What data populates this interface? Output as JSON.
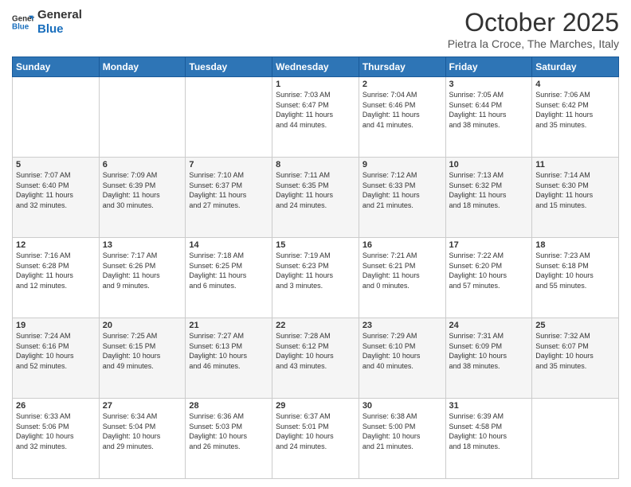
{
  "header": {
    "logo_line1": "General",
    "logo_line2": "Blue",
    "month_title": "October 2025",
    "location": "Pietra la Croce, The Marches, Italy"
  },
  "days_of_week": [
    "Sunday",
    "Monday",
    "Tuesday",
    "Wednesday",
    "Thursday",
    "Friday",
    "Saturday"
  ],
  "weeks": [
    [
      {
        "day": "",
        "info": ""
      },
      {
        "day": "",
        "info": ""
      },
      {
        "day": "",
        "info": ""
      },
      {
        "day": "1",
        "info": "Sunrise: 7:03 AM\nSunset: 6:47 PM\nDaylight: 11 hours\nand 44 minutes."
      },
      {
        "day": "2",
        "info": "Sunrise: 7:04 AM\nSunset: 6:46 PM\nDaylight: 11 hours\nand 41 minutes."
      },
      {
        "day": "3",
        "info": "Sunrise: 7:05 AM\nSunset: 6:44 PM\nDaylight: 11 hours\nand 38 minutes."
      },
      {
        "day": "4",
        "info": "Sunrise: 7:06 AM\nSunset: 6:42 PM\nDaylight: 11 hours\nand 35 minutes."
      }
    ],
    [
      {
        "day": "5",
        "info": "Sunrise: 7:07 AM\nSunset: 6:40 PM\nDaylight: 11 hours\nand 32 minutes."
      },
      {
        "day": "6",
        "info": "Sunrise: 7:09 AM\nSunset: 6:39 PM\nDaylight: 11 hours\nand 30 minutes."
      },
      {
        "day": "7",
        "info": "Sunrise: 7:10 AM\nSunset: 6:37 PM\nDaylight: 11 hours\nand 27 minutes."
      },
      {
        "day": "8",
        "info": "Sunrise: 7:11 AM\nSunset: 6:35 PM\nDaylight: 11 hours\nand 24 minutes."
      },
      {
        "day": "9",
        "info": "Sunrise: 7:12 AM\nSunset: 6:33 PM\nDaylight: 11 hours\nand 21 minutes."
      },
      {
        "day": "10",
        "info": "Sunrise: 7:13 AM\nSunset: 6:32 PM\nDaylight: 11 hours\nand 18 minutes."
      },
      {
        "day": "11",
        "info": "Sunrise: 7:14 AM\nSunset: 6:30 PM\nDaylight: 11 hours\nand 15 minutes."
      }
    ],
    [
      {
        "day": "12",
        "info": "Sunrise: 7:16 AM\nSunset: 6:28 PM\nDaylight: 11 hours\nand 12 minutes."
      },
      {
        "day": "13",
        "info": "Sunrise: 7:17 AM\nSunset: 6:26 PM\nDaylight: 11 hours\nand 9 minutes."
      },
      {
        "day": "14",
        "info": "Sunrise: 7:18 AM\nSunset: 6:25 PM\nDaylight: 11 hours\nand 6 minutes."
      },
      {
        "day": "15",
        "info": "Sunrise: 7:19 AM\nSunset: 6:23 PM\nDaylight: 11 hours\nand 3 minutes."
      },
      {
        "day": "16",
        "info": "Sunrise: 7:21 AM\nSunset: 6:21 PM\nDaylight: 11 hours\nand 0 minutes."
      },
      {
        "day": "17",
        "info": "Sunrise: 7:22 AM\nSunset: 6:20 PM\nDaylight: 10 hours\nand 57 minutes."
      },
      {
        "day": "18",
        "info": "Sunrise: 7:23 AM\nSunset: 6:18 PM\nDaylight: 10 hours\nand 55 minutes."
      }
    ],
    [
      {
        "day": "19",
        "info": "Sunrise: 7:24 AM\nSunset: 6:16 PM\nDaylight: 10 hours\nand 52 minutes."
      },
      {
        "day": "20",
        "info": "Sunrise: 7:25 AM\nSunset: 6:15 PM\nDaylight: 10 hours\nand 49 minutes."
      },
      {
        "day": "21",
        "info": "Sunrise: 7:27 AM\nSunset: 6:13 PM\nDaylight: 10 hours\nand 46 minutes."
      },
      {
        "day": "22",
        "info": "Sunrise: 7:28 AM\nSunset: 6:12 PM\nDaylight: 10 hours\nand 43 minutes."
      },
      {
        "day": "23",
        "info": "Sunrise: 7:29 AM\nSunset: 6:10 PM\nDaylight: 10 hours\nand 40 minutes."
      },
      {
        "day": "24",
        "info": "Sunrise: 7:31 AM\nSunset: 6:09 PM\nDaylight: 10 hours\nand 38 minutes."
      },
      {
        "day": "25",
        "info": "Sunrise: 7:32 AM\nSunset: 6:07 PM\nDaylight: 10 hours\nand 35 minutes."
      }
    ],
    [
      {
        "day": "26",
        "info": "Sunrise: 6:33 AM\nSunset: 5:06 PM\nDaylight: 10 hours\nand 32 minutes."
      },
      {
        "day": "27",
        "info": "Sunrise: 6:34 AM\nSunset: 5:04 PM\nDaylight: 10 hours\nand 29 minutes."
      },
      {
        "day": "28",
        "info": "Sunrise: 6:36 AM\nSunset: 5:03 PM\nDaylight: 10 hours\nand 26 minutes."
      },
      {
        "day": "29",
        "info": "Sunrise: 6:37 AM\nSunset: 5:01 PM\nDaylight: 10 hours\nand 24 minutes."
      },
      {
        "day": "30",
        "info": "Sunrise: 6:38 AM\nSunset: 5:00 PM\nDaylight: 10 hours\nand 21 minutes."
      },
      {
        "day": "31",
        "info": "Sunrise: 6:39 AM\nSunset: 4:58 PM\nDaylight: 10 hours\nand 18 minutes."
      },
      {
        "day": "",
        "info": ""
      }
    ]
  ]
}
